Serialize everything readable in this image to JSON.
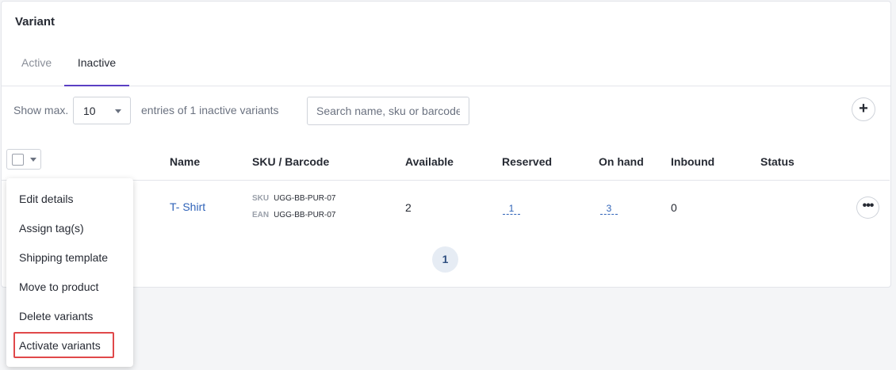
{
  "card": {
    "title": "Variant"
  },
  "tabs": [
    {
      "label": "Active",
      "selected": false
    },
    {
      "label": "Inactive",
      "selected": true
    }
  ],
  "toolbar": {
    "show_label": "Show max.",
    "page_size": "10",
    "entries_label": "entries of 1 inactive variants",
    "search_placeholder": "Search name, sku or barcode",
    "add_icon": "plus-icon"
  },
  "table": {
    "columns": [
      "Name",
      "SKU / Barcode",
      "Available",
      "Reserved",
      "On hand",
      "Inbound",
      "Status"
    ],
    "rows": [
      {
        "name": "T- Shirt",
        "sku_tag": "SKU",
        "sku": "UGG-BB-PUR-07",
        "ean_tag": "EAN",
        "ean": "UGG-BB-PUR-07",
        "available": "2",
        "reserved": "1",
        "on_hand": "3",
        "inbound": "0",
        "status": ""
      }
    ]
  },
  "pagination": {
    "current": "1"
  },
  "bulk_menu": {
    "items": [
      "Edit details",
      "Assign tag(s)",
      "Shipping template",
      "Move to product",
      "Delete variants",
      "Activate variants"
    ],
    "highlighted": "Activate variants"
  },
  "colors": {
    "accent": "#5b3fc4",
    "link": "#2f63b8",
    "highlight": "#e0484a"
  }
}
